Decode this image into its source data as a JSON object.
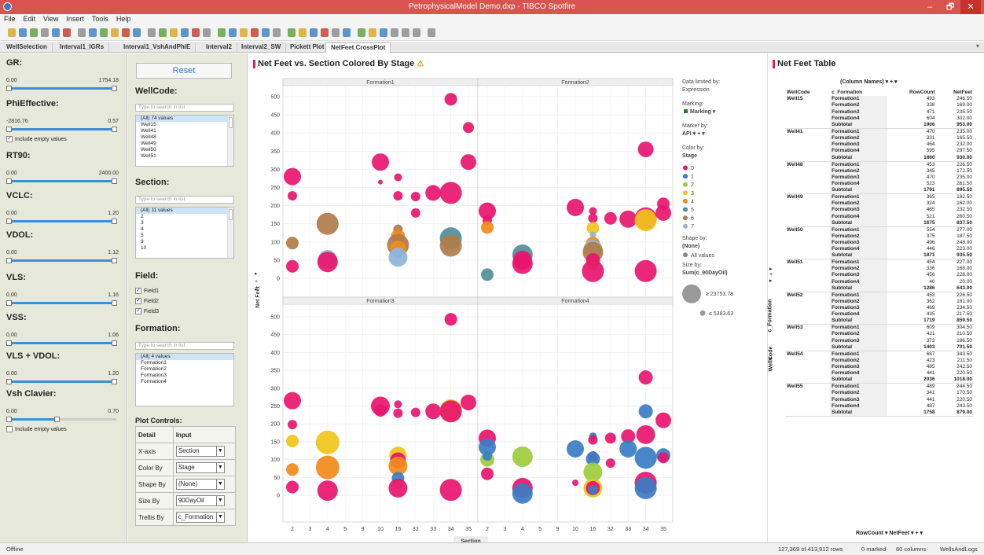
{
  "window": {
    "title": "PetrophysicalModel Demo.dxp - TIBCO Spotfire",
    "min_glyph": "–",
    "max_glyph": "🗗",
    "close_glyph": "✕"
  },
  "menu": [
    "File",
    "Edit",
    "View",
    "Insert",
    "Tools",
    "Help"
  ],
  "tabs": [
    "WellSelection",
    "Interval1_IGRs",
    "Interval1_VshAndPhiE",
    "Interval2",
    "Interval2_SW",
    "Pickett Plot",
    "NetFeet CrossPlot"
  ],
  "active_tab": 6,
  "left_filters": [
    {
      "label": "GR:",
      "min": "0.00",
      "max": "1754.18",
      "lo": 0.0,
      "hi": 1.0,
      "include_empty": false
    },
    {
      "label": "PhiEffective:",
      "min": "-2816.76",
      "max": "0.57",
      "lo": 0.0,
      "hi": 1.0,
      "include_empty": true,
      "include_label": "Include empty values"
    },
    {
      "label": "RT90:",
      "min": "0.00",
      "max": "2400.00",
      "lo": 0.0,
      "hi": 1.0,
      "include_empty": false
    },
    {
      "label": "VCLC:",
      "min": "0.00",
      "max": "1.20",
      "lo": 0.0,
      "hi": 1.0,
      "include_empty": false
    },
    {
      "label": "VDOL:",
      "min": "0.00",
      "max": "1.12",
      "lo": 0.0,
      "hi": 1.0,
      "include_empty": false
    },
    {
      "label": "VLS:",
      "min": "0.00",
      "max": "1.16",
      "lo": 0.0,
      "hi": 1.0,
      "include_empty": false
    },
    {
      "label": "VSS:",
      "min": "0.00",
      "max": "1.06",
      "lo": 0.0,
      "hi": 1.0,
      "include_empty": false
    },
    {
      "label": "VLS + VDOL:",
      "min": "0.00",
      "max": "1.20",
      "lo": 0.0,
      "hi": 1.0,
      "include_empty": false
    },
    {
      "label": "Vsh Clavier:",
      "min": "0.00",
      "max": "0.70",
      "lo": 0.0,
      "hi": 0.48,
      "include_empty": false,
      "include_label": "Include empty values",
      "show_unchecked": true
    }
  ],
  "filters": {
    "reset": "Reset",
    "search_placeholder": "Type to search in list",
    "wellcode": {
      "label": "WellCode:",
      "items": [
        "(All) 74 values",
        "Well15",
        "Well41",
        "Well48",
        "Well49",
        "Well50",
        "Well51"
      ]
    },
    "section": {
      "label": "Section:",
      "items": [
        "(All) 11 values",
        "2",
        "3",
        "4",
        "5",
        "9",
        "10"
      ]
    },
    "field": {
      "label": "Field:",
      "items": [
        "Field1",
        "Field2",
        "Field3"
      ]
    },
    "formation": {
      "label": "Formation:",
      "items": [
        "(All) 4 values",
        "Formation1",
        "Formation2",
        "Formation3",
        "Formation4"
      ]
    },
    "plot_controls": {
      "label": "Plot Controls:",
      "col1": "Detail",
      "col2": "Input",
      "rows": [
        [
          "X-axis",
          "Section"
        ],
        [
          "Color By",
          "Stage"
        ],
        [
          "Shape By",
          "(None)"
        ],
        [
          "Size By",
          "90DayOil"
        ],
        [
          "Trellis By",
          "c_Formation"
        ]
      ]
    }
  },
  "chart": {
    "title": "Net Feet vs. Section Colored By Stage",
    "warning_glyph": "⚠",
    "y_label": "Net Feet",
    "x_label": "Section",
    "legend": {
      "data_limited": "Data limited by:",
      "expression": "Expression",
      "marking_label": "Marking:",
      "marking_value": "Marking",
      "marker_by_label": "Marker by:",
      "marker_by_value": "API",
      "color_by_label": "Color by:",
      "color_by_value": "Stage",
      "shape_by_label": "Shape by:",
      "shape_by_value": "(None)",
      "all_values": "All values",
      "size_by_label": "Size by:",
      "size_by_value": "Sum(c_90DayOil)",
      "size_max": "≥ 23753.78",
      "size_min": "≤ 5383.63"
    }
  },
  "stage_colors": {
    "0": "#e8156e",
    "1": "#3a7dc4",
    "2": "#9ccc3c",
    "3": "#f0c419",
    "4": "#f28a1a",
    "5": "#4f8f99",
    "6": "#b07c4a",
    "7": "#8eb4d8"
  },
  "chart_data": {
    "type": "scatter",
    "title": "Net Feet vs. Section Colored By Stage",
    "xlabel": "Section",
    "ylabel": "Net Feet",
    "categories": [
      "2",
      "3",
      "4",
      "5",
      "9",
      "10",
      "16",
      "32",
      "33",
      "34",
      "35"
    ],
    "ylim": [
      0,
      500
    ],
    "yticks": [
      0,
      50,
      100,
      150,
      200,
      250,
      300,
      350,
      400,
      450,
      500
    ],
    "legend": [
      "0",
      "1",
      "2",
      "3",
      "4",
      "5",
      "6",
      "7"
    ],
    "panels": [
      {
        "name": "Formation1",
        "points": [
          [
            0,
            280,
            "0",
            11
          ],
          [
            0,
            227,
            "0",
            6
          ],
          [
            0,
            97,
            "6",
            8
          ],
          [
            0,
            33,
            "0",
            8
          ],
          [
            2,
            150,
            "6",
            14
          ],
          [
            2,
            52,
            "7",
            12
          ],
          [
            2,
            45,
            "0",
            13
          ],
          [
            5,
            320,
            "0",
            11
          ],
          [
            5,
            265,
            "0",
            3
          ],
          [
            6,
            278,
            "0",
            5
          ],
          [
            6,
            227,
            "0",
            6
          ],
          [
            6,
            135,
            "6",
            6
          ],
          [
            6,
            115,
            "4",
            9
          ],
          [
            6,
            92,
            "6",
            14
          ],
          [
            6,
            82,
            "4",
            10
          ],
          [
            6,
            70,
            "7",
            7
          ],
          [
            6,
            58,
            "7",
            12
          ],
          [
            7,
            225,
            "0",
            6
          ],
          [
            7,
            180,
            "0",
            6
          ],
          [
            8,
            235,
            "0",
            10
          ],
          [
            9,
            493,
            "0",
            8
          ],
          [
            9,
            235,
            "0",
            14
          ],
          [
            9,
            110,
            "5",
            14
          ],
          [
            9,
            90,
            "6",
            14
          ],
          [
            10,
            415,
            "0",
            7
          ],
          [
            10,
            320,
            "0",
            10
          ]
        ]
      },
      {
        "name": "Formation2",
        "points": [
          [
            0,
            185,
            "0",
            11
          ],
          [
            0,
            160,
            "0",
            6
          ],
          [
            0,
            140,
            "4",
            8
          ],
          [
            0,
            10,
            "5",
            8
          ],
          [
            2,
            65,
            "5",
            13
          ],
          [
            2,
            50,
            "0",
            12
          ],
          [
            2,
            40,
            "0",
            13
          ],
          [
            5,
            195,
            "0",
            11
          ],
          [
            6,
            185,
            "0",
            5
          ],
          [
            6,
            165,
            "0",
            6
          ],
          [
            6,
            138,
            "3",
            8
          ],
          [
            6,
            120,
            "7",
            4
          ],
          [
            6,
            95,
            "4",
            9
          ],
          [
            6,
            80,
            "7",
            12
          ],
          [
            6,
            72,
            "6",
            13
          ],
          [
            6,
            50,
            "0",
            9
          ],
          [
            6,
            35,
            "2",
            6
          ],
          [
            6,
            20,
            "0",
            14
          ],
          [
            7,
            165,
            "0",
            8
          ],
          [
            8,
            163,
            "0",
            11
          ],
          [
            9,
            355,
            "0",
            10
          ],
          [
            9,
            165,
            "0",
            14
          ],
          [
            9,
            160,
            "3",
            14
          ],
          [
            9,
            20,
            "0",
            14
          ],
          [
            10,
            205,
            "0",
            8
          ],
          [
            10,
            180,
            "0",
            10
          ]
        ]
      },
      {
        "name": "Formation3",
        "points": [
          [
            0,
            265,
            "0",
            11
          ],
          [
            0,
            198,
            "0",
            6
          ],
          [
            0,
            152,
            "3",
            8
          ],
          [
            0,
            72,
            "4",
            8
          ],
          [
            0,
            23,
            "0",
            8
          ],
          [
            2,
            148,
            "3",
            15
          ],
          [
            2,
            78,
            "4",
            15
          ],
          [
            2,
            13,
            "0",
            13
          ],
          [
            5,
            250,
            "0",
            12
          ],
          [
            5,
            238,
            "0",
            8
          ],
          [
            6,
            255,
            "0",
            5
          ],
          [
            6,
            230,
            "0",
            6
          ],
          [
            6,
            112,
            "3",
            11
          ],
          [
            6,
            98,
            "0",
            10
          ],
          [
            6,
            82,
            "4",
            12
          ],
          [
            6,
            48,
            "1",
            8
          ],
          [
            6,
            30,
            "2",
            6
          ],
          [
            6,
            20,
            "0",
            12
          ],
          [
            7,
            232,
            "0",
            6
          ],
          [
            8,
            235,
            "0",
            10
          ],
          [
            9,
            493,
            "0",
            8
          ],
          [
            9,
            238,
            "3",
            14
          ],
          [
            9,
            235,
            "0",
            14
          ],
          [
            9,
            15,
            "0",
            14
          ],
          [
            10,
            260,
            "0",
            10
          ]
        ]
      },
      {
        "name": "Formation4",
        "points": [
          [
            0,
            160,
            "0",
            11
          ],
          [
            0,
            135,
            "1",
            11
          ],
          [
            0,
            100,
            "2",
            9
          ],
          [
            0,
            110,
            "1",
            6
          ],
          [
            0,
            60,
            "0",
            8
          ],
          [
            2,
            108,
            "2",
            13
          ],
          [
            2,
            20,
            "0",
            13
          ],
          [
            2,
            5,
            "1",
            13
          ],
          [
            5,
            130,
            "1",
            11
          ],
          [
            5,
            35,
            "0",
            4
          ],
          [
            6,
            165,
            "1",
            5
          ],
          [
            6,
            155,
            "0",
            6
          ],
          [
            6,
            110,
            "0",
            6
          ],
          [
            6,
            102,
            "1",
            9
          ],
          [
            6,
            65,
            "2",
            12
          ],
          [
            6,
            20,
            "3",
            12
          ],
          [
            6,
            20,
            "0",
            9
          ],
          [
            6,
            15,
            "1",
            6
          ],
          [
            7,
            90,
            "0",
            6
          ],
          [
            7,
            160,
            "0",
            7
          ],
          [
            8,
            165,
            "0",
            9
          ],
          [
            8,
            130,
            "1",
            11
          ],
          [
            9,
            330,
            "0",
            9
          ],
          [
            9,
            235,
            "1",
            9
          ],
          [
            9,
            170,
            "0",
            12
          ],
          [
            9,
            105,
            "1",
            14
          ],
          [
            9,
            35,
            "0",
            14
          ],
          [
            9,
            20,
            "1",
            14
          ],
          [
            10,
            210,
            "0",
            10
          ],
          [
            10,
            112,
            "1",
            9
          ],
          [
            10,
            105,
            "0",
            7
          ]
        ]
      }
    ]
  },
  "table": {
    "title": "Net Feet Table",
    "column_names": "(Column Names)",
    "headers": [
      "WellCode",
      "c_Formation",
      "RowCount",
      "NetFeet"
    ],
    "row_axis": "WellCode",
    "row_axis2": "c_Formation",
    "footer_a": "RowCount",
    "footer_b": "NetFeet",
    "rows": [
      [
        "Well15",
        "Formation1",
        "493",
        "246.50"
      ],
      [
        "",
        "Formation2",
        "338",
        "169.00"
      ],
      [
        "",
        "Formation3",
        "471",
        "235.50"
      ],
      [
        "",
        "Formation4",
        "604",
        "302.00"
      ],
      [
        "",
        "Subtotal",
        "1906",
        "953.00"
      ],
      [
        "Well41",
        "Formation1",
        "470",
        "235.00"
      ],
      [
        "",
        "Formation2",
        "331",
        "165.50"
      ],
      [
        "",
        "Formation3",
        "464",
        "232.00"
      ],
      [
        "",
        "Formation4",
        "595",
        "297.50"
      ],
      [
        "",
        "Subtotal",
        "1860",
        "930.00"
      ],
      [
        "Well48",
        "Formation1",
        "453",
        "226.50"
      ],
      [
        "",
        "Formation2",
        "345",
        "172.50"
      ],
      [
        "",
        "Formation3",
        "470",
        "235.00"
      ],
      [
        "",
        "Formation4",
        "523",
        "261.50"
      ],
      [
        "",
        "Subtotal",
        "1791",
        "895.50"
      ],
      [
        "Well49",
        "Formation1",
        "365",
        "182.50"
      ],
      [
        "",
        "Formation2",
        "324",
        "162.00"
      ],
      [
        "",
        "Formation3",
        "465",
        "232.50"
      ],
      [
        "",
        "Formation4",
        "521",
        "260.50"
      ],
      [
        "",
        "Subtotal",
        "1675",
        "837.50"
      ],
      [
        "Well50",
        "Formation1",
        "554",
        "277.00"
      ],
      [
        "",
        "Formation2",
        "375",
        "187.50"
      ],
      [
        "",
        "Formation3",
        "496",
        "248.00"
      ],
      [
        "",
        "Formation4",
        "446",
        "223.00"
      ],
      [
        "",
        "Subtotal",
        "1871",
        "935.50"
      ],
      [
        "Well51",
        "Formation1",
        "454",
        "227.00"
      ],
      [
        "",
        "Formation2",
        "336",
        "168.00"
      ],
      [
        "",
        "Formation3",
        "456",
        "228.00"
      ],
      [
        "",
        "Formation4",
        "40",
        "20.00"
      ],
      [
        "",
        "Subtotal",
        "1286",
        "643.00"
      ],
      [
        "Well52",
        "Formation1",
        "453",
        "226.50"
      ],
      [
        "",
        "Formation2",
        "362",
        "181.00"
      ],
      [
        "",
        "Formation3",
        "469",
        "234.50"
      ],
      [
        "",
        "Formation4",
        "435",
        "217.50"
      ],
      [
        "",
        "Subtotal",
        "1719",
        "859.50"
      ],
      [
        "Well53",
        "Formation1",
        "609",
        "304.50"
      ],
      [
        "",
        "Formation2",
        "421",
        "210.50"
      ],
      [
        "",
        "Formation3",
        "373",
        "186.50"
      ],
      [
        "",
        "Subtotal",
        "1403",
        "701.50"
      ],
      [
        "Well54",
        "Formation1",
        "687",
        "343.50"
      ],
      [
        "",
        "Formation2",
        "423",
        "211.50"
      ],
      [
        "",
        "Formation3",
        "485",
        "242.50"
      ],
      [
        "",
        "Formation4",
        "441",
        "220.50"
      ],
      [
        "",
        "Subtotal",
        "2036",
        "1018.00"
      ],
      [
        "Well55",
        "Formation1",
        "489",
        "244.50"
      ],
      [
        "",
        "Formation2",
        "341",
        "170.50"
      ],
      [
        "",
        "Formation3",
        "441",
        "220.50"
      ],
      [
        "",
        "Formation4",
        "487",
        "243.50"
      ],
      [
        "",
        "Subtotal",
        "1758",
        "879.00"
      ]
    ]
  },
  "status": {
    "left": "Offline",
    "rows": "127,369 of 413,912 rows",
    "marked": "0 marked",
    "columns": "60 columns",
    "table": "WellsAndLogs"
  }
}
